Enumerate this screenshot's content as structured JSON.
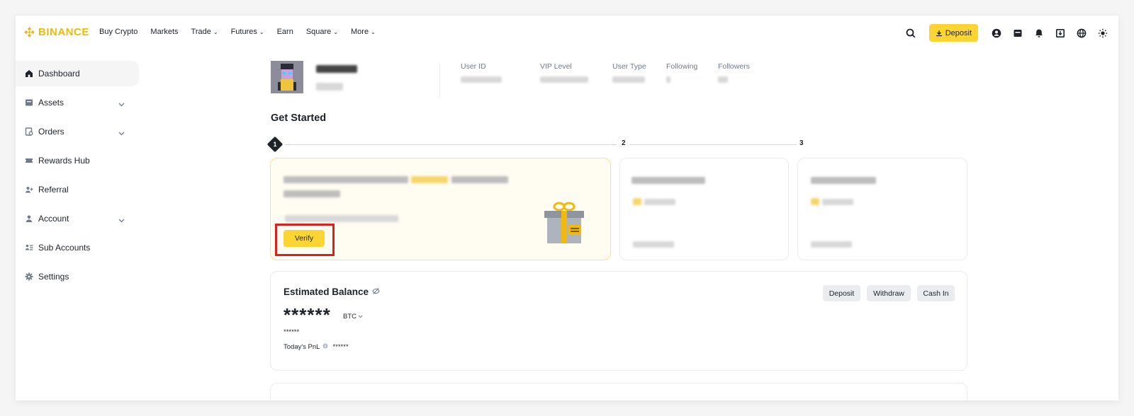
{
  "header": {
    "brand": "BINANCE",
    "nav": [
      {
        "label": "Buy Crypto",
        "has_caret": false
      },
      {
        "label": "Markets",
        "has_caret": false
      },
      {
        "label": "Trade",
        "has_caret": true
      },
      {
        "label": "Futures",
        "has_caret": true
      },
      {
        "label": "Earn",
        "has_caret": false
      },
      {
        "label": "Square",
        "has_caret": true
      },
      {
        "label": "More",
        "has_caret": true
      }
    ],
    "deposit_label": "Deposit",
    "icons": [
      "search-icon",
      "profile-icon",
      "wallet-icon",
      "bell-icon",
      "download-icon",
      "globe-icon",
      "theme-icon"
    ]
  },
  "sidebar": {
    "items": [
      {
        "label": "Dashboard",
        "icon": "home-icon",
        "active": true,
        "expandable": false
      },
      {
        "label": "Assets",
        "icon": "wallet-icon",
        "active": false,
        "expandable": true
      },
      {
        "label": "Orders",
        "icon": "orders-icon",
        "active": false,
        "expandable": true
      },
      {
        "label": "Rewards Hub",
        "icon": "ticket-icon",
        "active": false,
        "expandable": false
      },
      {
        "label": "Referral",
        "icon": "user-plus-icon",
        "active": false,
        "expandable": false
      },
      {
        "label": "Account",
        "icon": "user-icon",
        "active": false,
        "expandable": true
      },
      {
        "label": "Sub Accounts",
        "icon": "sub-accounts-icon",
        "active": false,
        "expandable": false
      },
      {
        "label": "Settings",
        "icon": "gear-icon",
        "active": false,
        "expandable": false
      }
    ]
  },
  "profile": {
    "stats": [
      {
        "label": "User ID"
      },
      {
        "label": "VIP Level"
      },
      {
        "label": "User Type"
      },
      {
        "label": "Following"
      },
      {
        "label": "Followers"
      }
    ]
  },
  "get_started": {
    "title": "Get Started",
    "steps": [
      "1",
      "2",
      "3"
    ],
    "verify_label": "Verify"
  },
  "balance": {
    "title": "Estimated Balance",
    "masked_value": "******",
    "unit": "BTC",
    "masked_fiat": "******",
    "pnl_label": "Today's PnL",
    "pnl_value": "******",
    "buttons": [
      "Deposit",
      "Withdraw",
      "Cash In"
    ]
  },
  "colors": {
    "brand": "#f0b90b",
    "button_yellow": "#fcd535",
    "highlight_red": "#d9211d"
  }
}
